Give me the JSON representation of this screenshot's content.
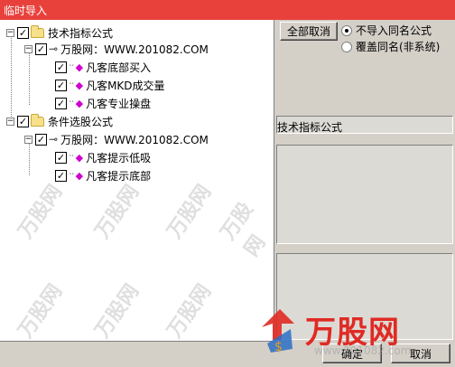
{
  "window": {
    "title": "临时导入"
  },
  "tree": {
    "groups": [
      {
        "label": "技术指标公式",
        "site": "万股网：WWW.201082.COM",
        "items": [
          "凡客底部买入",
          "凡客MKD成交量",
          "凡客专业操盘"
        ]
      },
      {
        "label": "条件选股公式",
        "site": "万股网：WWW.201082.COM",
        "items": [
          "凡客提示低吸",
          "凡客提示底部"
        ]
      }
    ]
  },
  "right": {
    "deselect_all": "全部取消",
    "radio_skip": "不导入同名公式",
    "radio_overwrite": "覆盖同名(非系统)",
    "type_label": "技术指标公式"
  },
  "bottom": {
    "ok": "确定",
    "cancel": "取消"
  },
  "watermark": {
    "brand": "万股网",
    "url": "www.201082.com"
  },
  "colors": {
    "titlebar": "#e8413c",
    "brand": "#e02a24"
  }
}
